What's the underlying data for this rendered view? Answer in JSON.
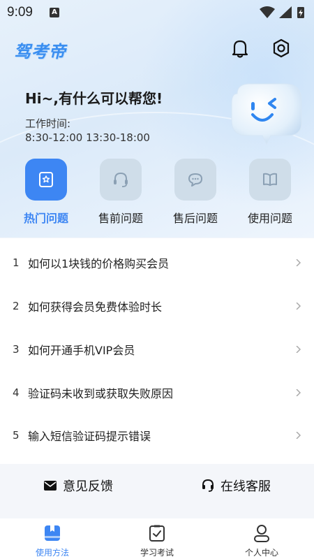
{
  "status_bar": {
    "time": "9:09",
    "notif_icon_letter": "A"
  },
  "header": {
    "app_name": "驾考帝"
  },
  "greeting": "Hi~,有什么可以帮您!",
  "work": {
    "label": "工作时间:",
    "hours": "8:30-12:00 13:30-18:00"
  },
  "categories": [
    {
      "label": "热门问题",
      "icon": "star-bookmark-icon",
      "active": true
    },
    {
      "label": "售前问题",
      "icon": "headset-icon",
      "active": false
    },
    {
      "label": "售后问题",
      "icon": "chat-bubble-icon",
      "active": false
    },
    {
      "label": "使用问题",
      "icon": "open-book-icon",
      "active": false
    }
  ],
  "questions": [
    {
      "num": "1",
      "text": "如何以1块钱的价格购买会员"
    },
    {
      "num": "2",
      "text": "如何获得会员免费体验时长"
    },
    {
      "num": "3",
      "text": "如何开通手机VIP会员"
    },
    {
      "num": "4",
      "text": "验证码未收到或获取失败原因"
    },
    {
      "num": "5",
      "text": "输入短信验证码提示错误"
    }
  ],
  "contact": {
    "feedback": "意见反馈",
    "service": "在线客服"
  },
  "tabs": [
    {
      "label": "使用方法",
      "active": true
    },
    {
      "label": "学习考试",
      "active": false
    },
    {
      "label": "个人中心",
      "active": false
    }
  ],
  "colors": {
    "accent": "#3d86f3",
    "inactive_tile": "#cfdde9"
  }
}
